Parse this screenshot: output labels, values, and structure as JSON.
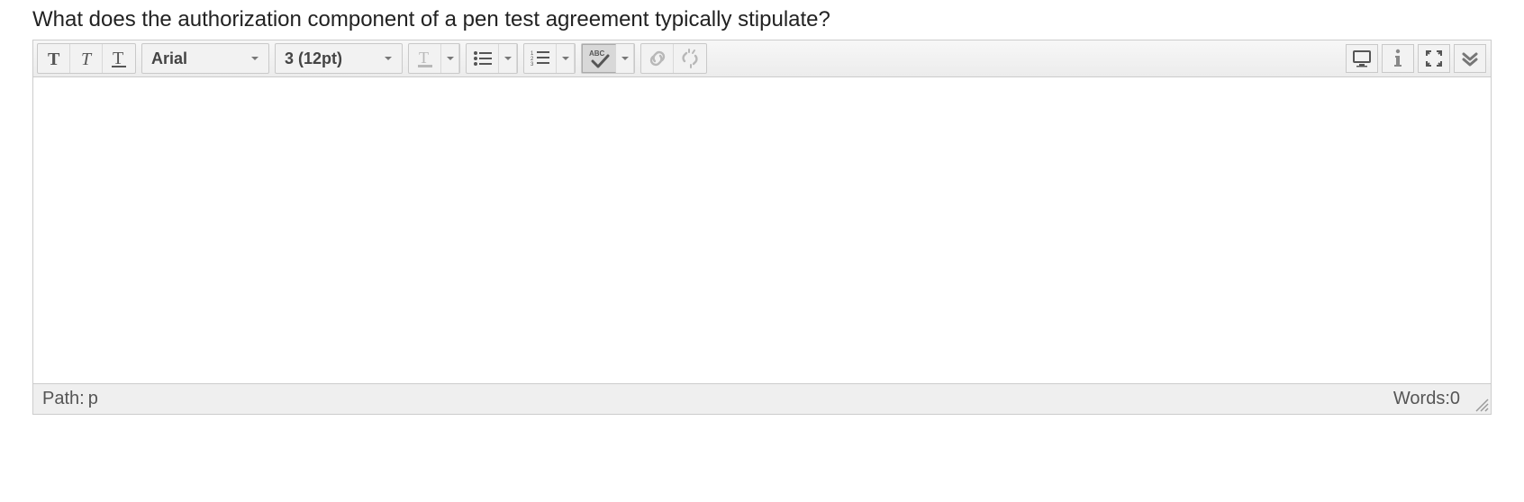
{
  "question": "What does the authorization component of a pen test agreement typically stipulate?",
  "toolbar": {
    "font_family": "Arial",
    "font_size": "3 (12pt)"
  },
  "status": {
    "path_label": "Path: ",
    "path_value": "p",
    "words_label": "Words:",
    "words_count": "0"
  },
  "icons": {
    "bold": "bold-icon",
    "italic": "italic-icon",
    "underline": "underline-icon",
    "textcolor": "text-color-icon",
    "bullets": "bullet-list-icon",
    "numbers": "numbered-list-icon",
    "spellcheck": "spellcheck-icon",
    "link": "link-icon",
    "unlink": "unlink-icon",
    "preview": "preview-icon",
    "info": "info-icon",
    "fullscreen": "fullscreen-icon",
    "more": "more-icon"
  }
}
